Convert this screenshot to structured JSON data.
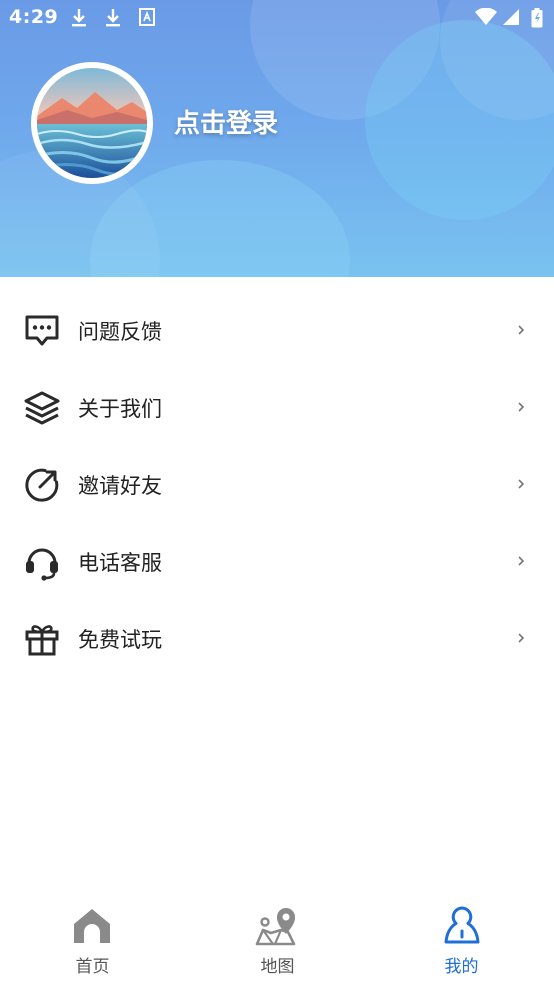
{
  "status_bar": {
    "time": "4:29"
  },
  "profile": {
    "login_text": "点击登录"
  },
  "menu": [
    {
      "label": "问题反馈",
      "icon": "chat-bubble-icon"
    },
    {
      "label": "关于我们",
      "icon": "layers-icon"
    },
    {
      "label": "邀请好友",
      "icon": "share-arrow-icon"
    },
    {
      "label": "电话客服",
      "icon": "headset-icon"
    },
    {
      "label": "免费试玩",
      "icon": "gift-icon"
    }
  ],
  "bottom_nav": [
    {
      "label": "首页",
      "icon": "home-icon",
      "active": false
    },
    {
      "label": "地图",
      "icon": "map-pin-icon",
      "active": false
    },
    {
      "label": "我的",
      "icon": "user-icon",
      "active": true
    }
  ],
  "colors": {
    "accent": "#1f6fd6",
    "header_start": "#6a9ae6",
    "header_end": "#79c3f0"
  }
}
